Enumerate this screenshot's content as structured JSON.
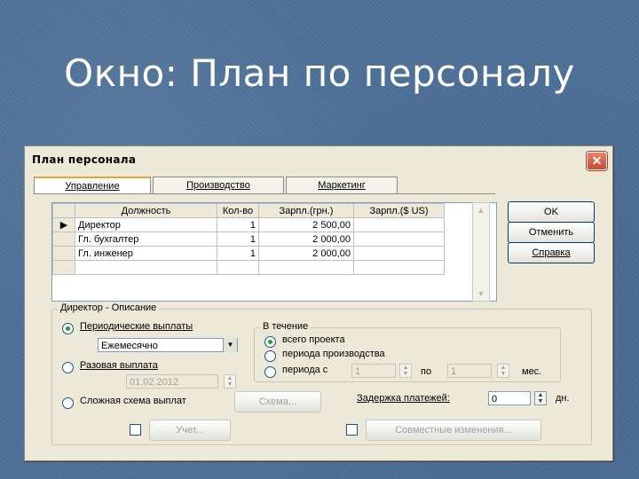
{
  "slide": {
    "title": "Окно: План по персоналу"
  },
  "window": {
    "title": "План персонала",
    "close_icon": "close-icon"
  },
  "tabs": [
    {
      "label": "Управление",
      "active": true
    },
    {
      "label": "Производство",
      "active": false
    },
    {
      "label": "Маркетинг",
      "active": false
    }
  ],
  "grid": {
    "columns": [
      "Должность",
      "Кол-во",
      "Зарпл.(грн.)",
      "Зарпл.($ US)"
    ],
    "rows": [
      {
        "position": "Директор",
        "qty": "1",
        "salary_uah": "2 500,00",
        "salary_usd": "",
        "current": true
      },
      {
        "position": "Гл. бухгалтер",
        "qty": "1",
        "salary_uah": "2 000,00",
        "salary_usd": ""
      },
      {
        "position": "Гл. инженер",
        "qty": "1",
        "salary_uah": "2 000,00",
        "salary_usd": ""
      }
    ]
  },
  "buttons": {
    "ok": "OK",
    "cancel": "Отменить",
    "help": "Справка"
  },
  "description": {
    "group_label": "Директор - Описание",
    "periodic_label": "Периодические выплаты",
    "periodic_value": "Ежемесячно",
    "onetime_label": "Разовая выплата",
    "onetime_date": "01.02.2012",
    "complex_label": "Сложная схема выплат",
    "scheme_button": "Схема...",
    "during": {
      "group_label": "В течение",
      "whole_project": "всего проекта",
      "production_period": "периода производства",
      "period_from": "периода с",
      "from_value": "1",
      "to_label": "по",
      "to_value": "1",
      "months": "мес."
    },
    "payment_delay_label": "Задержка платежей:",
    "payment_delay_value": "0",
    "days": "дн.",
    "account_button": "Учет...",
    "joint_button": "Совместные изменения..."
  },
  "colors": {
    "slide_background": "#4d6f97",
    "window_face": "#ece9d8",
    "active_tab_accent": "#e7a43a"
  }
}
